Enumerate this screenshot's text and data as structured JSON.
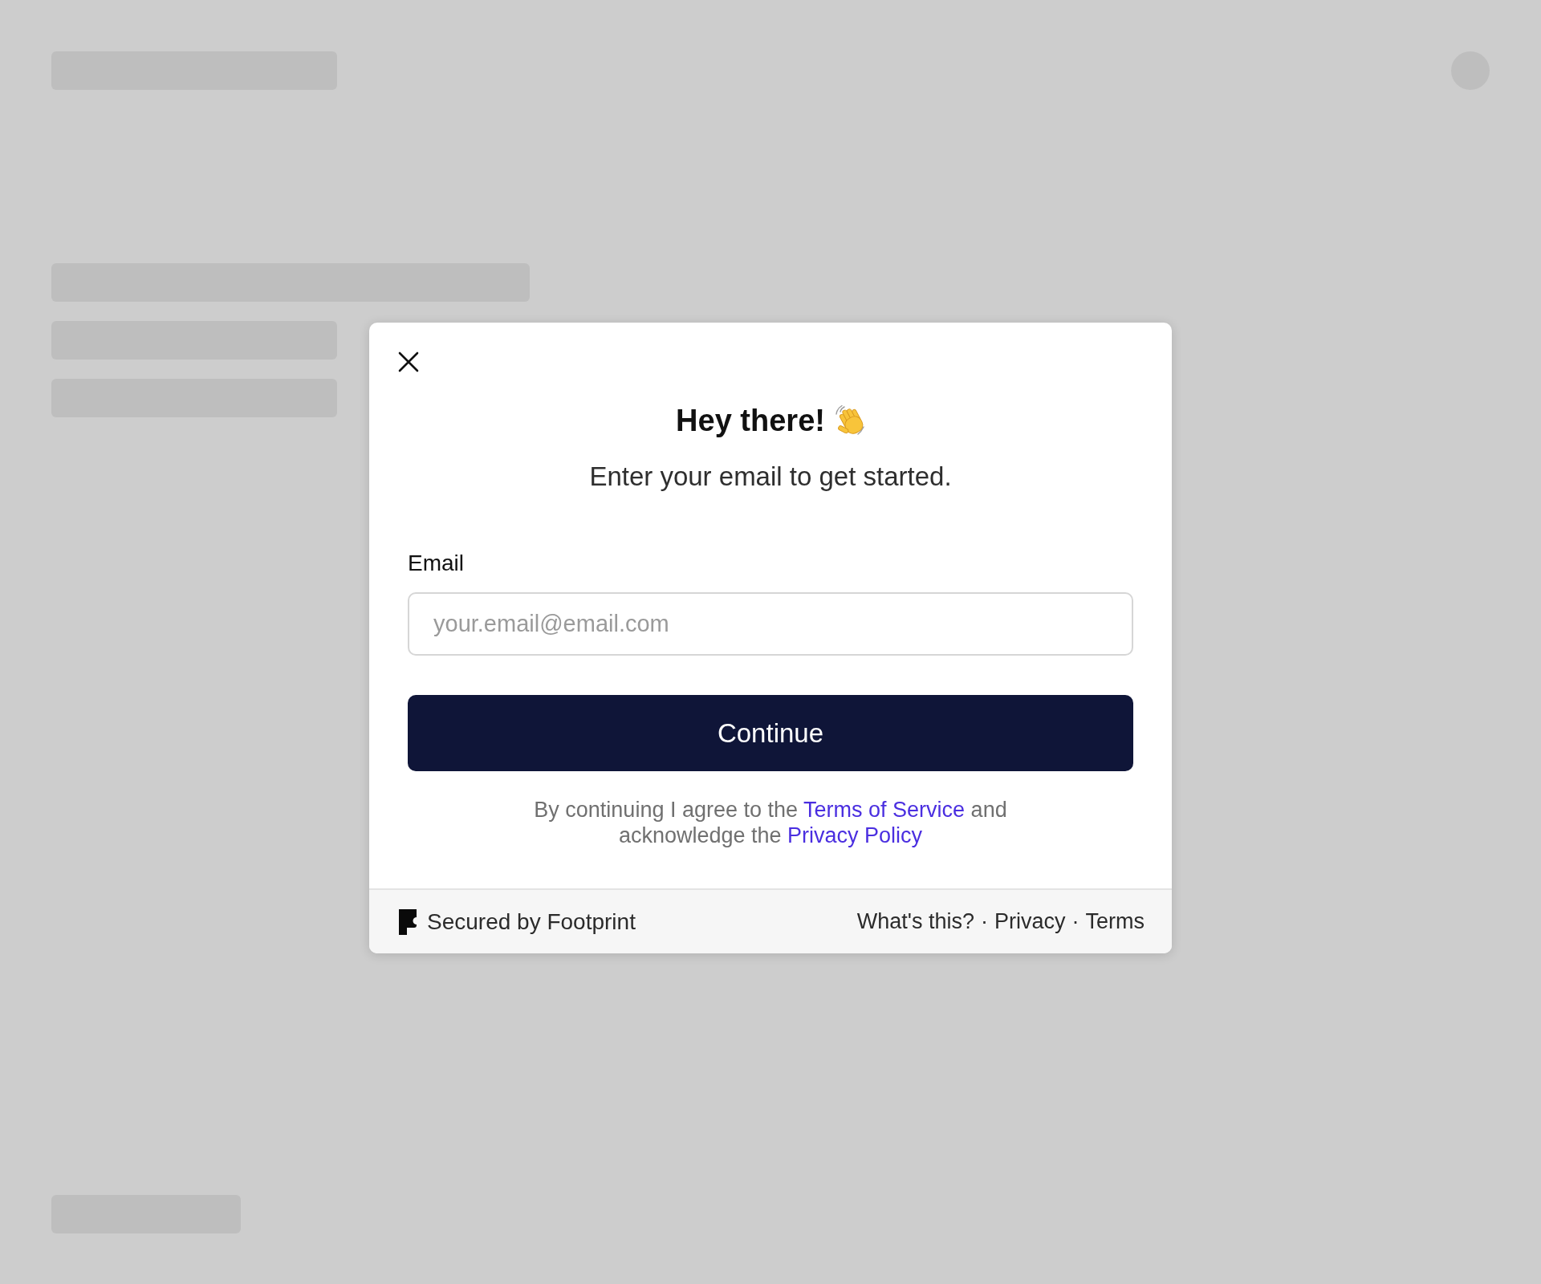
{
  "dialog": {
    "title": "Hey there!",
    "subtitle": "Enter your email to get started.",
    "email_field": {
      "label": "Email",
      "placeholder": "your.email@email.com"
    },
    "continue_button": "Continue",
    "consent": [
      [
        {
          "kind": "text",
          "text": "By continuing I agree to the "
        },
        {
          "kind": "link",
          "text": "Terms of Service"
        },
        {
          "kind": "text",
          "text": " and"
        }
      ],
      [
        {
          "kind": "text",
          "text": "acknowledge the "
        },
        {
          "kind": "link",
          "text": "Privacy Policy"
        }
      ]
    ],
    "footer": {
      "brand": "Secured by Footprint",
      "links": [
        "What's this?",
        "Privacy",
        "Terms"
      ],
      "separator": "·"
    }
  }
}
